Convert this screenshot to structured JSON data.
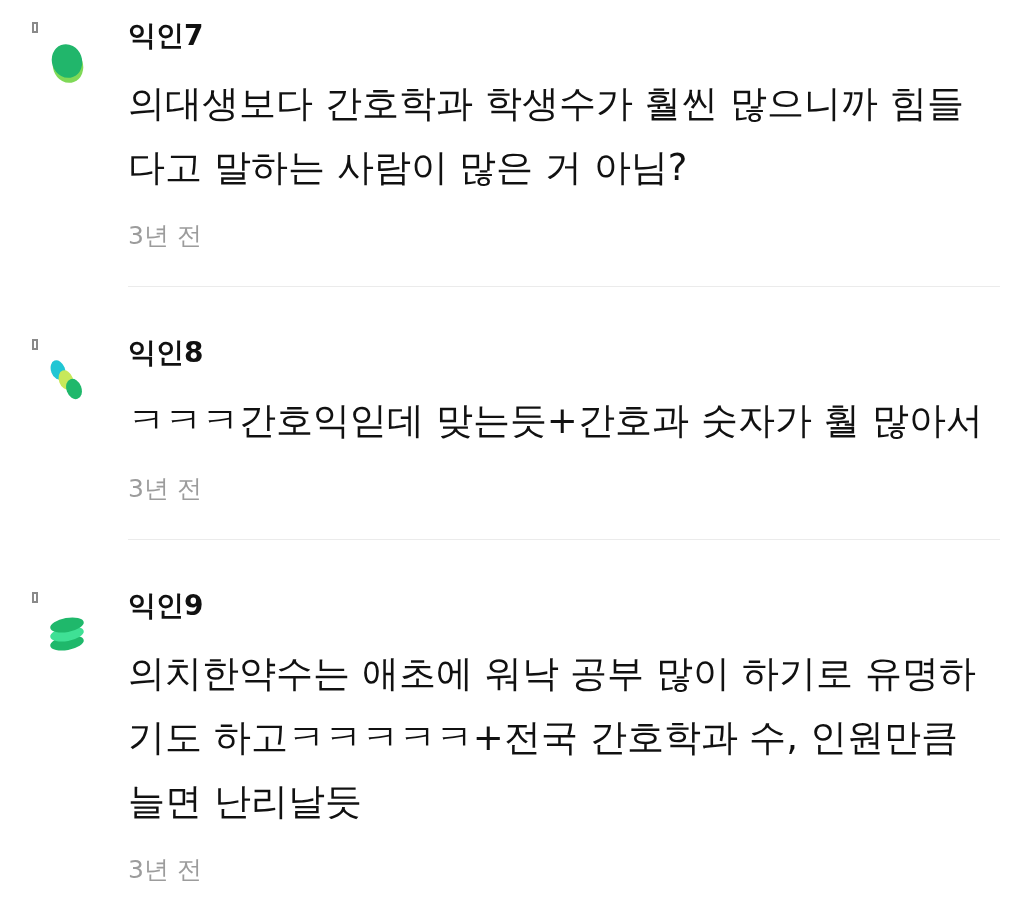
{
  "comments": [
    {
      "avatar": {
        "kind": "oval"
      },
      "author": "익인7",
      "body": "의대생보다 간호학과 학생수가 훨씬 많으니까 힘들다고 말하는 사람이 많은 거 아님?",
      "time": "3년 전"
    },
    {
      "avatar": {
        "kind": "trio"
      },
      "author": "익인8",
      "body": "ㅋㅋㅋ간호익읻데 맞는듯+간호과 숫자가 훨 많아서",
      "time": "3년 전"
    },
    {
      "avatar": {
        "kind": "stack"
      },
      "author": "익인9",
      "body": "의치한약수는 애초에 워낙 공부 많이 하기로 유명하기도 하고ㅋㅋㅋㅋㅋ+전국 간호학과 수, 인원만큼 늘면 난리날듯",
      "time": "3년 전"
    }
  ]
}
